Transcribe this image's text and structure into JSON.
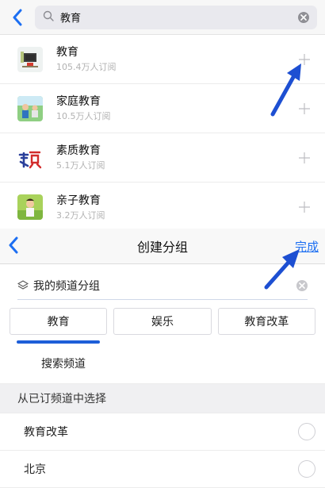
{
  "search": {
    "query": "教育",
    "results": [
      {
        "name": "教育",
        "subscribers": "105.4万人订阅"
      },
      {
        "name": "家庭教育",
        "subscribers": "10.5万人订阅"
      },
      {
        "name": "素质教育",
        "subscribers": "5.1万人订阅"
      },
      {
        "name": "亲子教育",
        "subscribers": "3.2万人订阅"
      }
    ]
  },
  "group": {
    "title": "创建分组",
    "done_label": "完成",
    "name_value": "我的频道分组",
    "chips": [
      "教育",
      "娱乐",
      "教育改革"
    ],
    "search_channel_label": "搜索频道",
    "section_label": "从已订频道中选择",
    "channels": [
      "教育改革",
      "北京"
    ]
  },
  "colors": {
    "accent": "#1d6ff2",
    "annotation_arrow": "#1d4fd2"
  },
  "icons": {
    "back": "chevron-left-icon",
    "search": "magnifier-icon",
    "clear": "close-circle-icon",
    "add": "plus-icon",
    "layers": "layers-icon"
  }
}
